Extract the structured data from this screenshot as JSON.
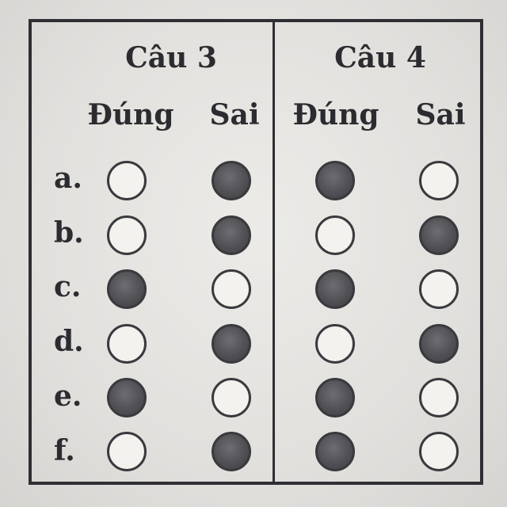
{
  "questions": [
    {
      "title": "Câu 3",
      "true_label": "Đúng",
      "false_label": "Sai"
    },
    {
      "title": "Câu 4",
      "true_label": "Đúng",
      "false_label": "Sai"
    }
  ],
  "rows": [
    "a.",
    "b.",
    "c.",
    "d.",
    "e.",
    "f."
  ],
  "answers": {
    "cau3": [
      "Sai",
      "Sai",
      "Đúng",
      "Sai",
      "Đúng",
      "Sai"
    ],
    "cau4": [
      "Đúng",
      "Sai",
      "Đúng",
      "Sai",
      "Đúng",
      "Đúng"
    ]
  },
  "colors": {
    "ink": "#2c2c30",
    "filled_bubble": "#515155",
    "empty_bubble": "#f3f2ef"
  }
}
